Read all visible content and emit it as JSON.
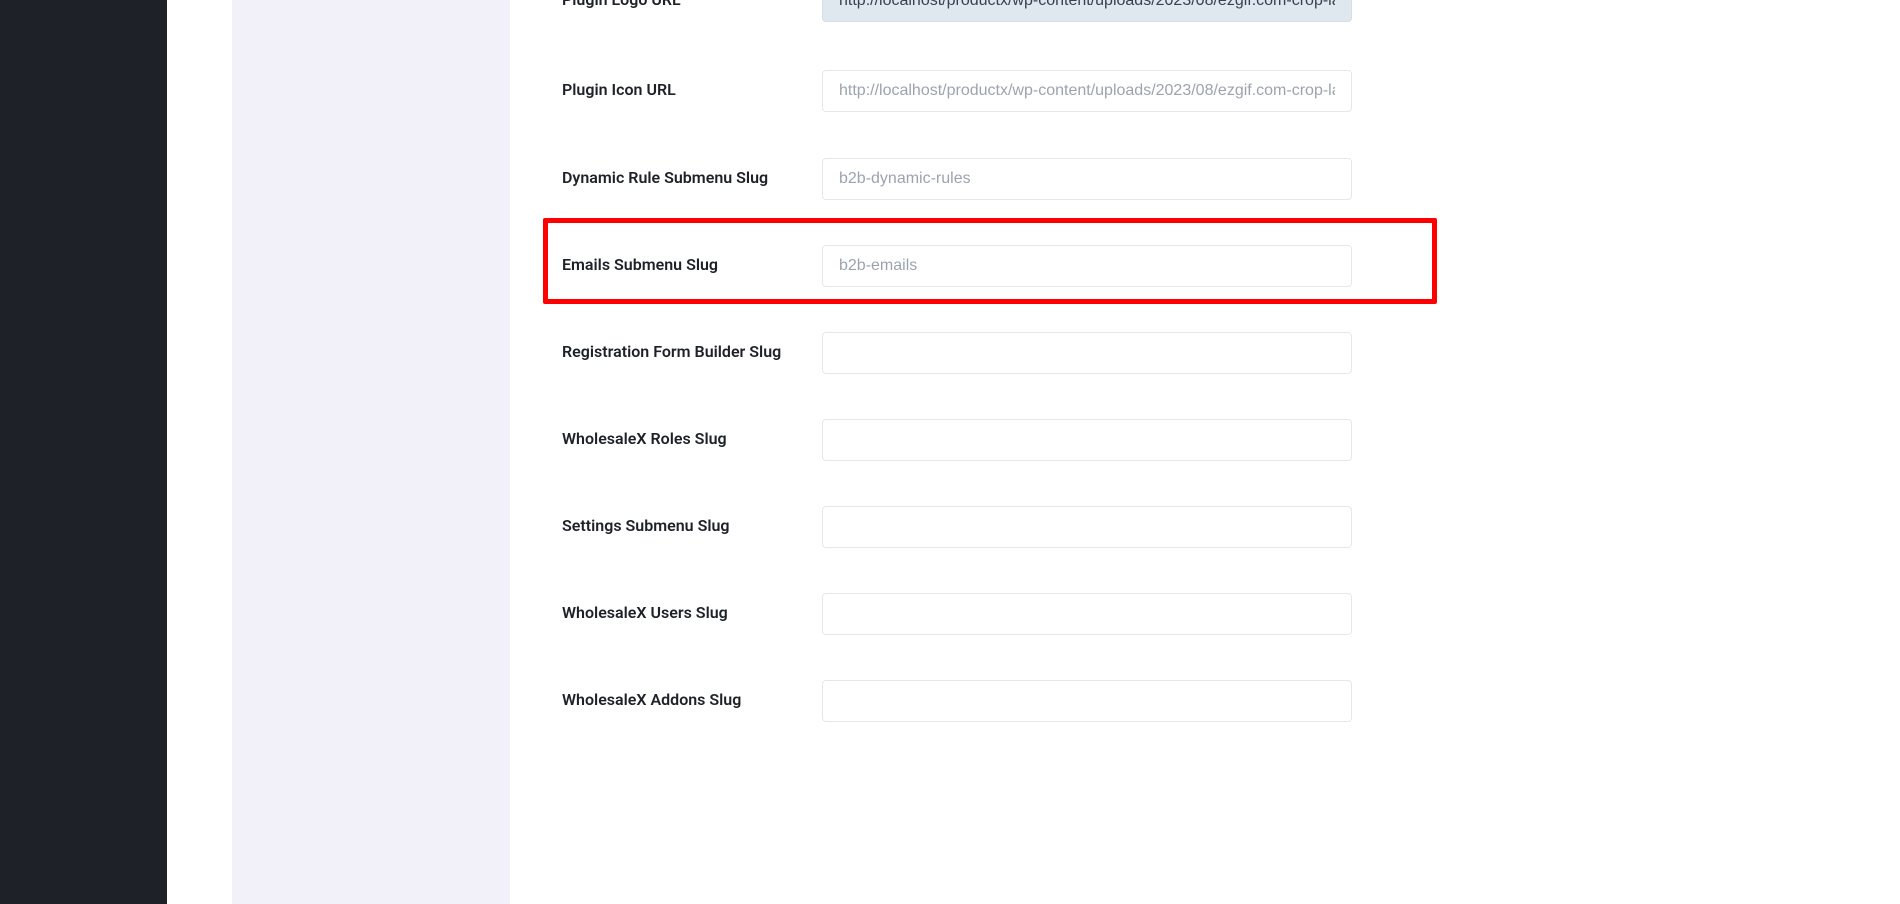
{
  "fields": {
    "plugin_logo_url": {
      "label": "Plugin Logo URL",
      "value": "http://localhost/productx/wp-content/uploads/2023/08/ezgif.com-crop-lat.gif",
      "placeholder": ""
    },
    "plugin_icon_url": {
      "label": "Plugin Icon URL",
      "value": "",
      "placeholder": "http://localhost/productx/wp-content/uploads/2023/08/ezgif.com-crop-lat.gif"
    },
    "dynamic_rule_slug": {
      "label": "Dynamic Rule Submenu Slug",
      "value": "",
      "placeholder": "b2b-dynamic-rules"
    },
    "emails_slug": {
      "label": "Emails Submenu Slug",
      "value": "",
      "placeholder": "b2b-emails"
    },
    "registration_slug": {
      "label": "Registration Form Builder Slug",
      "value": "",
      "placeholder": ""
    },
    "roles_slug": {
      "label": "WholesaleX Roles Slug",
      "value": "",
      "placeholder": ""
    },
    "settings_slug": {
      "label": "Settings Submenu Slug",
      "value": "",
      "placeholder": ""
    },
    "users_slug": {
      "label": "WholesaleX Users Slug",
      "value": "",
      "placeholder": ""
    },
    "addons_slug": {
      "label": "WholesaleX Addons Slug",
      "value": "",
      "placeholder": ""
    }
  }
}
